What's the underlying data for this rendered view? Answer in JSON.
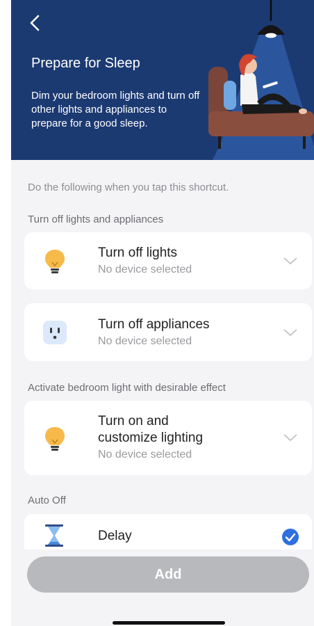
{
  "header": {
    "title": "Prepare for Sleep",
    "description": "Dim your bedroom lights and turn off other lights and appliances to prepare for a good sleep.",
    "back_icon": "chevron-left-icon"
  },
  "instructions": "Do the following when you tap this shortcut.",
  "sections": {
    "turn_off": "Turn off lights and appliances",
    "activate": "Activate bedroom light with desirable effect",
    "auto_off": "Auto Off"
  },
  "cards": {
    "lights": {
      "title": "Turn off lights",
      "subtitle": "No device selected",
      "icon": "lightbulb-icon"
    },
    "appliances": {
      "title": "Turn off appliances",
      "subtitle": "No device selected",
      "icon": "outlet-icon"
    },
    "lighting": {
      "title_line1": "Turn on and",
      "title_line2": "customize lighting",
      "subtitle": "No device selected",
      "icon": "lightbulb-icon"
    },
    "delay": {
      "title": "Delay",
      "icon": "hourglass-icon",
      "checked": true
    }
  },
  "button": {
    "add_label": "Add"
  },
  "colors": {
    "header_bg": "#1c3a72",
    "accent": "#2f6fe0",
    "bulb": "#f7b94a",
    "outlet_bg": "#dbe9fb",
    "button_disabled": "#b7b9bc"
  }
}
